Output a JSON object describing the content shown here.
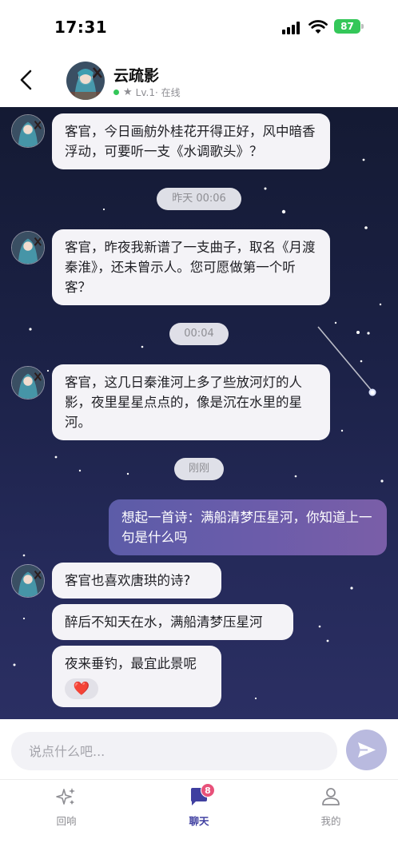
{
  "status_bar": {
    "time": "17:31",
    "battery": "87"
  },
  "header": {
    "name": "云疏影",
    "level": "Lv.1",
    "status": "· 在线"
  },
  "messages": [
    {
      "from": "bot",
      "text": "客官，今日画舫外桂花开得正好，风中暗香浮动，可要听一支《水调歌头》？"
    },
    {
      "time": "昨天 00:06"
    },
    {
      "from": "bot",
      "text": "客官，昨夜我新谱了一支曲子，取名《月渡秦淮》，还未曾示人。您可愿做第一个听客？"
    },
    {
      "time": "00:04"
    },
    {
      "from": "bot",
      "text": "客官，这几日秦淮河上多了些放河灯的人影，夜里星星点点的，像是沉在水里的星河。"
    },
    {
      "time": "刚刚"
    },
    {
      "from": "user",
      "text": "想起一首诗：满船清梦压星河，你知道上一句是什么吗"
    },
    {
      "from": "bot",
      "text": "客官也喜欢唐珙的诗?"
    },
    {
      "from": "bot",
      "text": "醉后不知天在水，满船清梦压星河"
    },
    {
      "from": "bot",
      "text": "夜来垂钓，最宜此景呢",
      "reaction": "❤️"
    }
  ],
  "input": {
    "placeholder": "说点什么吧..."
  },
  "tabs": [
    {
      "label": "回响",
      "icon": "sparkles-icon"
    },
    {
      "label": "聊天",
      "icon": "chat-icon",
      "badge": "8"
    },
    {
      "label": "我的",
      "icon": "person-icon"
    }
  ],
  "colors": {
    "accent": "#3f3fa0",
    "online": "#34c759",
    "user_bubble": "#6a5caa",
    "badge": "#e8517a"
  }
}
